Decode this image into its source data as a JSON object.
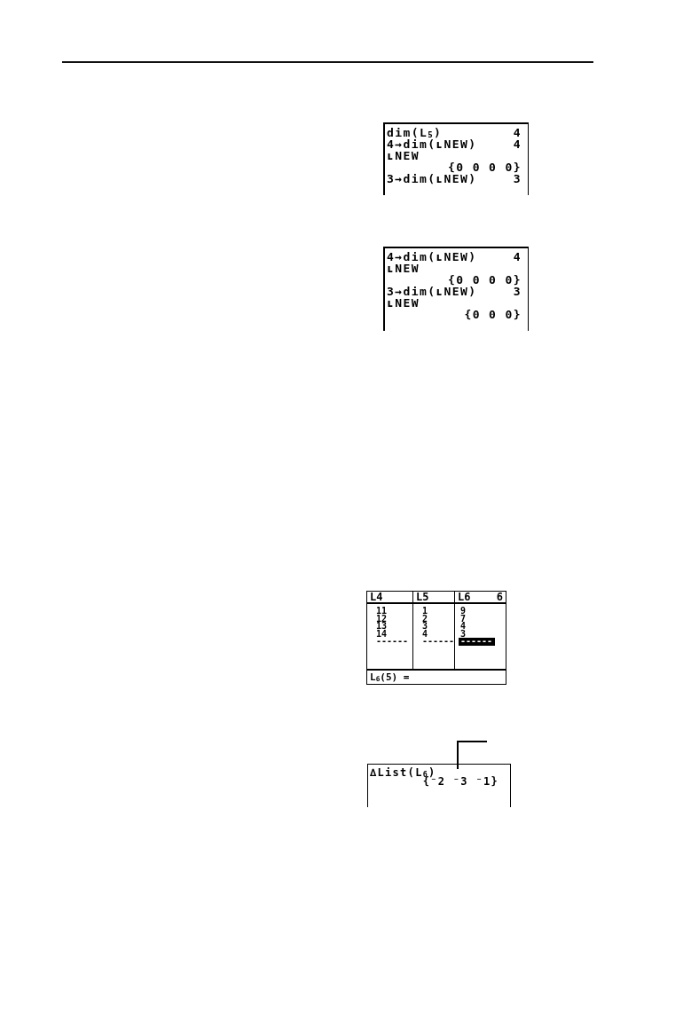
{
  "screens": [
    {
      "kind": "home",
      "callout": false,
      "lines": [
        {
          "input": "dim(L$_{5}$)",
          "output": "4"
        },
        {
          "input": "4→dim(ʟNEW)",
          "output": "4"
        },
        {
          "input": "ʟNEW"
        },
        {
          "output": "{0 0 0 0}"
        },
        {
          "input": "3→dim(ʟNEW)",
          "output": "3"
        }
      ]
    },
    {
      "kind": "home",
      "callout": false,
      "lines": [
        {
          "input": "4→dim(ʟNEW)",
          "output": "4"
        },
        {
          "input": "ʟNEW"
        },
        {
          "output": "{0 0 0 0}"
        },
        {
          "input": "3→dim(ʟNEW)",
          "output": "3"
        },
        {
          "input": "ʟNEW"
        },
        {
          "output": "{0 0 0}"
        }
      ]
    },
    {
      "kind": "list_editor",
      "callout": false,
      "columns": [
        {
          "header": "L4",
          "cells": [
            {
              "text": "11",
              "selected": false
            },
            {
              "text": "12",
              "selected": false
            },
            {
              "text": "13",
              "selected": false
            },
            {
              "text": "14",
              "selected": false
            },
            {
              "text": "------",
              "selected": false
            }
          ]
        },
        {
          "header": "L5",
          "cells": [
            {
              "text": "1",
              "selected": false
            },
            {
              "text": "2",
              "selected": false
            },
            {
              "text": "3",
              "selected": false
            },
            {
              "text": "4",
              "selected": false
            },
            {
              "text": "------",
              "selected": false
            }
          ]
        },
        {
          "header": "L6",
          "cells": [
            {
              "text": "9",
              "selected": false
            },
            {
              "text": "7",
              "selected": false
            },
            {
              "text": "4",
              "selected": false
            },
            {
              "text": "3",
              "selected": false
            },
            {
              "text": "------",
              "selected": true
            }
          ]
        }
      ],
      "column_number": "6",
      "entry_line": "L$_{6}$(5) ="
    },
    {
      "kind": "home",
      "callout": true,
      "lines": [
        {
          "input": "∆List(L$_{6}$)"
        },
        {
          "output": "{⁻2 ⁻3 ⁻1}"
        }
      ]
    }
  ]
}
